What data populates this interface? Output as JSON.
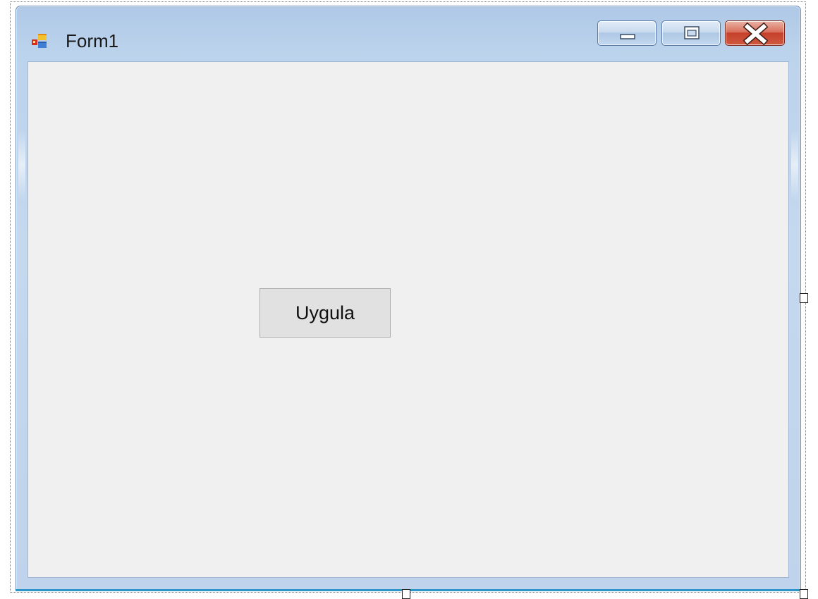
{
  "window": {
    "title": "Form1",
    "icon": "winforms-form-icon",
    "controls": {
      "minimize": "minimize-icon",
      "maximize": "maximize-icon",
      "close": "close-icon"
    }
  },
  "form": {
    "apply_button_label": "Uygula"
  },
  "colors": {
    "client_background": "#f0f0f0",
    "button_background": "#e1e1e1",
    "frame_blue": "#bfd4ec",
    "close_red": "#c5412b"
  }
}
